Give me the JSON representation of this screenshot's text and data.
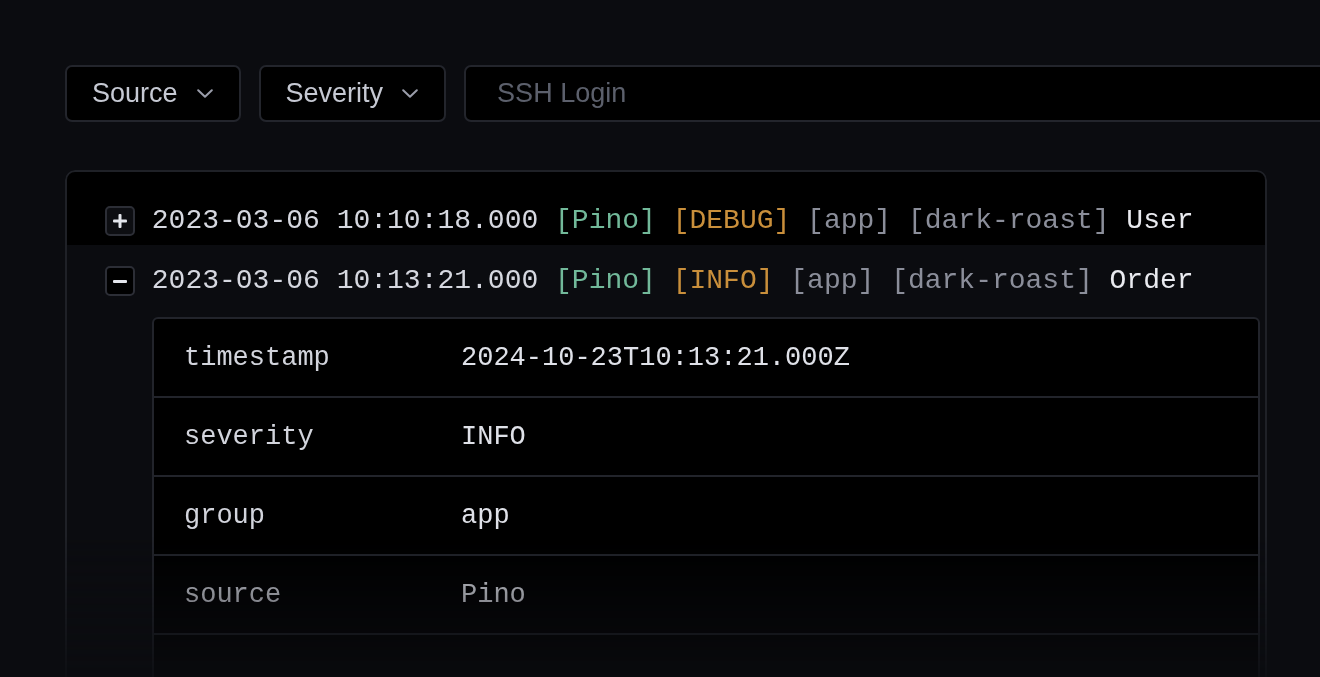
{
  "filters": [
    {
      "label": "Source"
    },
    {
      "label": "Severity"
    }
  ],
  "search": {
    "placeholder": "SSH Login"
  },
  "entries": [
    {
      "expanded": false,
      "timestamp": "2023-03-06 10:10:18.000",
      "source": "[Pino]",
      "severity": "[DEBUG]",
      "group": "[app]",
      "logger": "[dark-roast]",
      "message": "User"
    },
    {
      "expanded": true,
      "timestamp": "2023-03-06 10:13:21.000",
      "source": "[Pino]",
      "severity": "[INFO]",
      "group": "[app]",
      "logger": "[dark-roast]",
      "message": "Order",
      "details": [
        {
          "key": "timestamp",
          "value": "2024-10-23T10:13:21.000Z"
        },
        {
          "key": "severity",
          "value": "INFO"
        },
        {
          "key": "group",
          "value": "app"
        },
        {
          "key": "source",
          "value": "Pino"
        }
      ]
    }
  ]
}
